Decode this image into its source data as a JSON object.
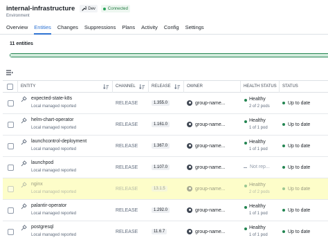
{
  "environment": {
    "name": "internal-infrastructure",
    "type": "Environment",
    "tag": "Dev",
    "status": "Connected",
    "colors": {
      "connected": "#29a35a",
      "accent": "#2d72d2"
    }
  },
  "tabs": [
    {
      "label": "Overview",
      "active": false
    },
    {
      "label": "Entities",
      "active": true
    },
    {
      "label": "Changes",
      "active": false
    },
    {
      "label": "Suppressions",
      "active": false
    },
    {
      "label": "Plans",
      "active": false
    },
    {
      "label": "Activity",
      "active": false
    },
    {
      "label": "Config",
      "active": false
    },
    {
      "label": "Settings",
      "active": false
    }
  ],
  "summary": {
    "count_label": "11 entities"
  },
  "columns": {
    "entity": "ENTITY",
    "channel": "CHANNEL",
    "release": "RELEASE",
    "owner": "OWNER",
    "health": "HEALTH STATUS",
    "status": "STATUS"
  },
  "rows": [
    {
      "name": "expected-state-k8s",
      "sub": "Local managed reported",
      "channel": "RELEASE",
      "release": "1.355.0",
      "owner": "group-name...",
      "health": "Healthy",
      "health_sub": "2 of 2 pods",
      "status": "Up to date"
    },
    {
      "name": "helm-chart-operator",
      "sub": "Local managed reported",
      "channel": "RELEASE",
      "release": "1.161.0",
      "owner": "group-name...",
      "health": "Healthy",
      "health_sub": "1 of 1 pod",
      "status": "Up to date"
    },
    {
      "name": "launchcontrol-deployment",
      "sub": "Local managed reported",
      "channel": "RELEASE",
      "release": "1.367.0",
      "owner": "group-name...",
      "health": "Healthy",
      "health_sub": "1 of 1 pod",
      "status": "Up to date"
    },
    {
      "name": "launchpod",
      "sub": "Local managed reported",
      "channel": "RELEASE",
      "release": "1.107.0",
      "owner": "group-name...",
      "health": "Not rep...",
      "health_sub": "",
      "status": "Up to date"
    },
    {
      "name": "nginx",
      "sub": "Local managed reported",
      "channel": "RELEASE",
      "release": "13.1.5",
      "owner": "group-name...",
      "health": "Healthy",
      "health_sub": "2 of 2 pods",
      "status": "Up to date"
    },
    {
      "name": "palantir-operator",
      "sub": "Local managed reported",
      "channel": "RELEASE",
      "release": "1.292.0",
      "owner": "group-name...",
      "health": "Healthy",
      "health_sub": "1 of 1 pod",
      "status": "Up to date"
    },
    {
      "name": "postgresql",
      "sub": "Local managed reported",
      "channel": "RELEASE",
      "release": "11.6.7",
      "owner": "group-name...",
      "health": "Healthy",
      "health_sub": "1 of 1 pod",
      "status": "Up to date"
    }
  ]
}
